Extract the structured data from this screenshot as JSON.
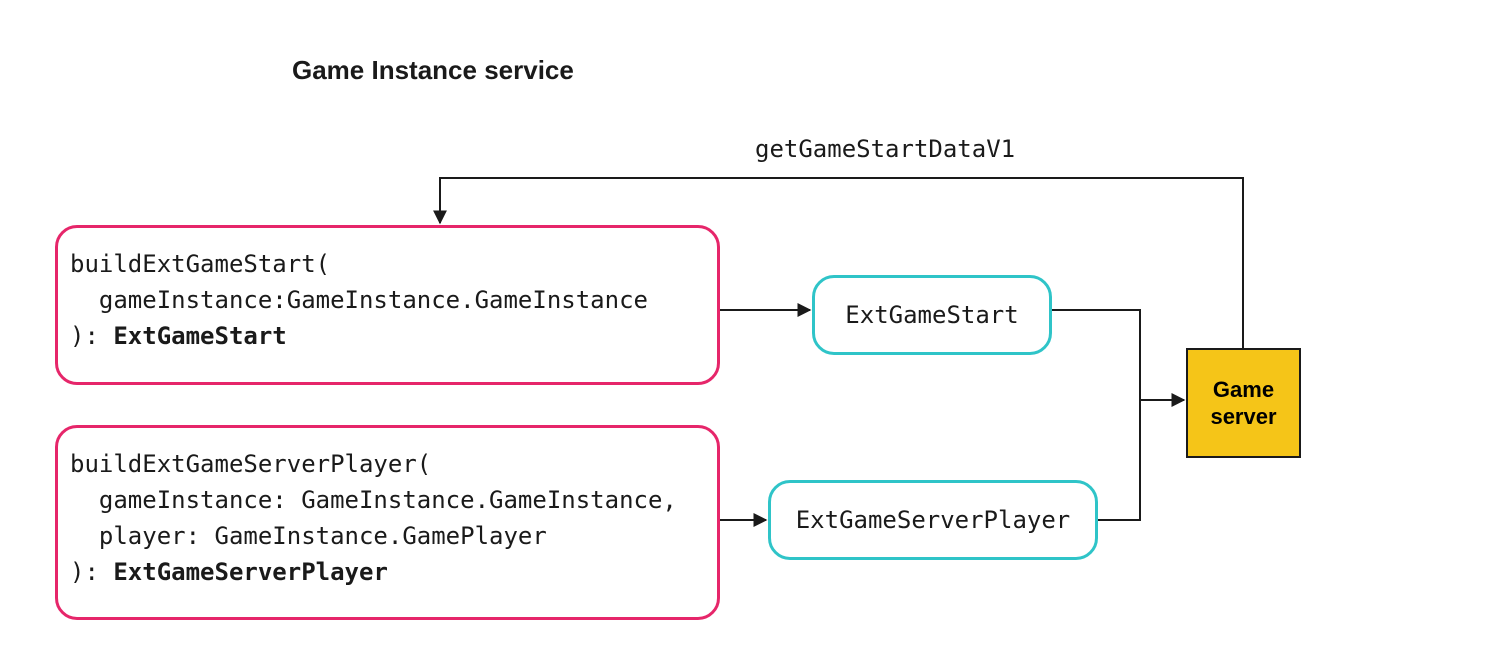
{
  "title": "Game Instance service",
  "flow_label": "getGameStartDataV1",
  "box1": {
    "line1": "buildExtGameStart(",
    "line2": "  gameInstance:GameInstance.GameInstance",
    "line3": "): ",
    "ret": "ExtGameStart"
  },
  "box2": {
    "line1": "buildExtGameServerPlayer(",
    "line2": "  gameInstance: GameInstance.GameInstance,",
    "line3": "  player: GameInstance.GamePlayer",
    "line4": "): ",
    "ret": "ExtGameServerPlayer"
  },
  "out1": "ExtGameStart",
  "out2": "ExtGameServerPlayer",
  "server_line1": "Game",
  "server_line2": "server"
}
